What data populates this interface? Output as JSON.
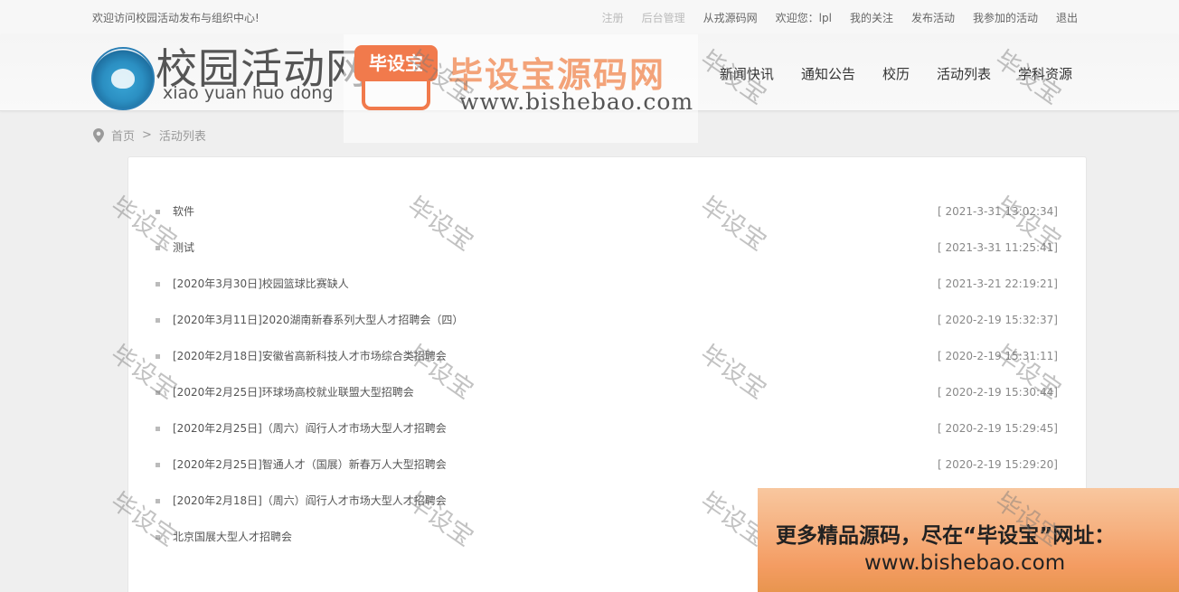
{
  "topbar": {
    "welcome": "欢迎访问校园活动发布与组织中心!",
    "links": [
      {
        "label": "注册",
        "faint": true
      },
      {
        "label": "后台管理",
        "faint": true
      },
      {
        "label": "从戎源码网",
        "faint": false
      },
      {
        "label": "欢迎您：lpl",
        "faint": false
      },
      {
        "label": "我的关注",
        "faint": false
      },
      {
        "label": "发布活动",
        "faint": false
      },
      {
        "label": "我参加的活动",
        "faint": false
      },
      {
        "label": "退出",
        "faint": false
      }
    ]
  },
  "header": {
    "title": "校园活动网",
    "pinyin": "xiao yuan huo dong",
    "nav": [
      "新闻快讯",
      "通知公告",
      "校历",
      "活动列表",
      "学科资源"
    ]
  },
  "watermark": {
    "badge": "毕设宝",
    "brand": "毕设宝源码网",
    "url": "www.bishebao.com",
    "diag_text": "毕设宝"
  },
  "breadcrumb": {
    "home": "首页",
    "separator": ">",
    "current": "活动列表"
  },
  "activities": [
    {
      "title": "软件",
      "date": "[ 2021-3-31 13:02:34]"
    },
    {
      "title": "测试",
      "date": "[ 2021-3-31 11:25:41]"
    },
    {
      "title": "[2020年3月30日]校园篮球比赛缺人",
      "date": "[ 2021-3-21 22:19:21]"
    },
    {
      "title": "[2020年3月11日]2020湖南新春系列大型人才招聘会（四）",
      "date": "[ 2020-2-19 15:32:37]"
    },
    {
      "title": "[2020年2月18日]安徽省高新科技人才市场综合类招聘会",
      "date": "[ 2020-2-19 15:31:11]"
    },
    {
      "title": "[2020年2月25日]环球场高校就业联盟大型招聘会",
      "date": "[ 2020-2-19 15:30:44]"
    },
    {
      "title": "[2020年2月25日]（周六）阎行人才市场大型人才招聘会",
      "date": "[ 2020-2-19 15:29:45]"
    },
    {
      "title": "[2020年2月25日]智通人才（国展）新春万人大型招聘会",
      "date": "[ 2020-2-19 15:29:20]"
    },
    {
      "title": "[2020年2月18日]（周六）阎行人才市场大型人才招聘会",
      "date": ""
    },
    {
      "title": "北京国展大型人才招聘会",
      "date": ""
    }
  ],
  "promo": {
    "line1": "更多精品源码，尽在“毕设宝”网址：",
    "line2": "www.bishebao.com"
  }
}
